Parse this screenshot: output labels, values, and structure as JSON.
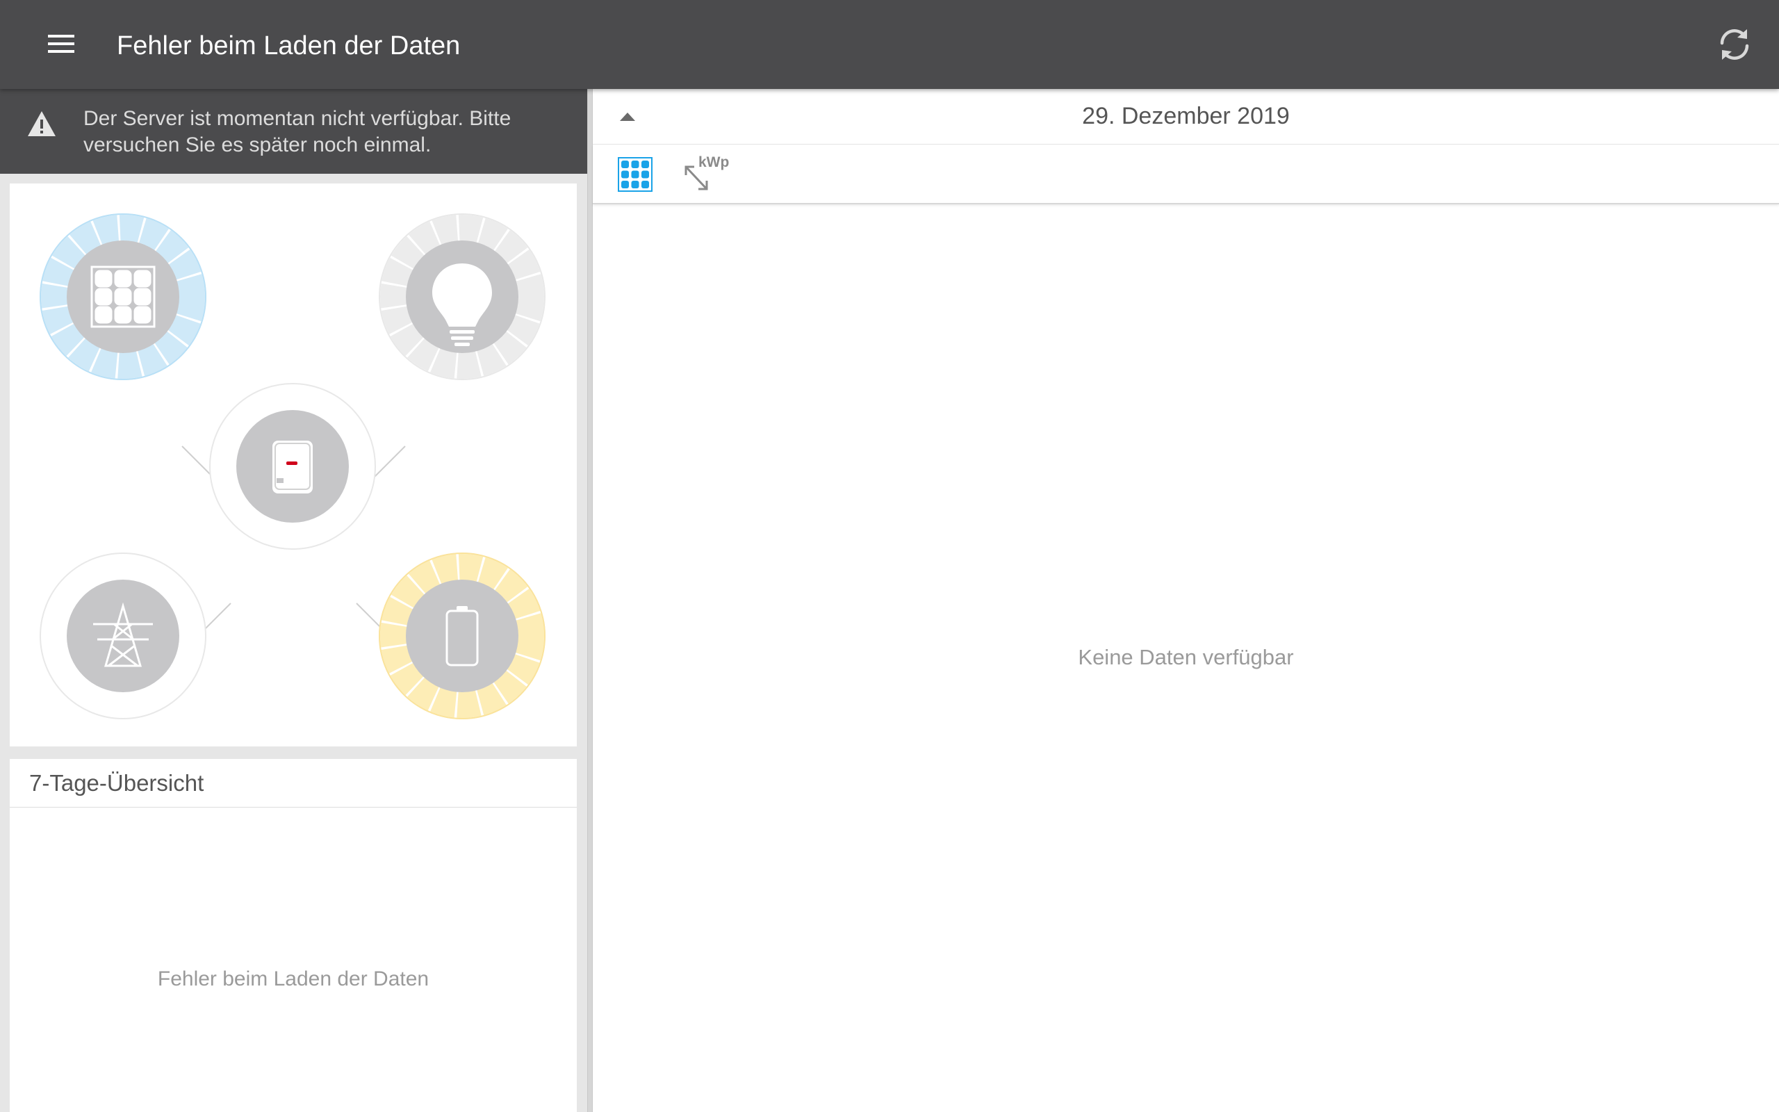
{
  "appbar": {
    "title": "Fehler beim Laden der Daten",
    "menu_icon": "menu-icon",
    "refresh_icon": "refresh-icon"
  },
  "banner": {
    "icon": "warning-icon",
    "message": "Der Server ist momentan nicht verfügbar. Bitte versuchen Sie es später noch einmal."
  },
  "flow": {
    "nodes": [
      {
        "name": "solar-panel-node",
        "icon": "solar-panel-icon",
        "ring_color": "#cfe9f8"
      },
      {
        "name": "consumption-node",
        "icon": "light-bulb-icon",
        "ring_color": "#ececec"
      },
      {
        "name": "inverter-node",
        "icon": "inverter-icon"
      },
      {
        "name": "grid-node",
        "icon": "power-tower-icon"
      },
      {
        "name": "battery-node",
        "icon": "battery-icon",
        "ring_color": "#fdedb6"
      }
    ]
  },
  "week": {
    "title": "7-Tage-Übersicht",
    "message": "Fehler beim Laden der Daten"
  },
  "detail": {
    "date": "29. Dezember 2019",
    "collapse_icon": "arrow-up-icon",
    "tools": [
      {
        "icon": "module-grid-icon",
        "active": true
      },
      {
        "icon": "resize-kwp-icon",
        "label": "kWp"
      }
    ],
    "message": "Keine Daten verfügbar"
  },
  "colors": {
    "appbar": "#4b4b4d",
    "accent": "#1aa3e8",
    "solar_ring": "#cfe9f8",
    "battery_ring": "#fdedb6",
    "node_fill": "#c6c6c8"
  }
}
